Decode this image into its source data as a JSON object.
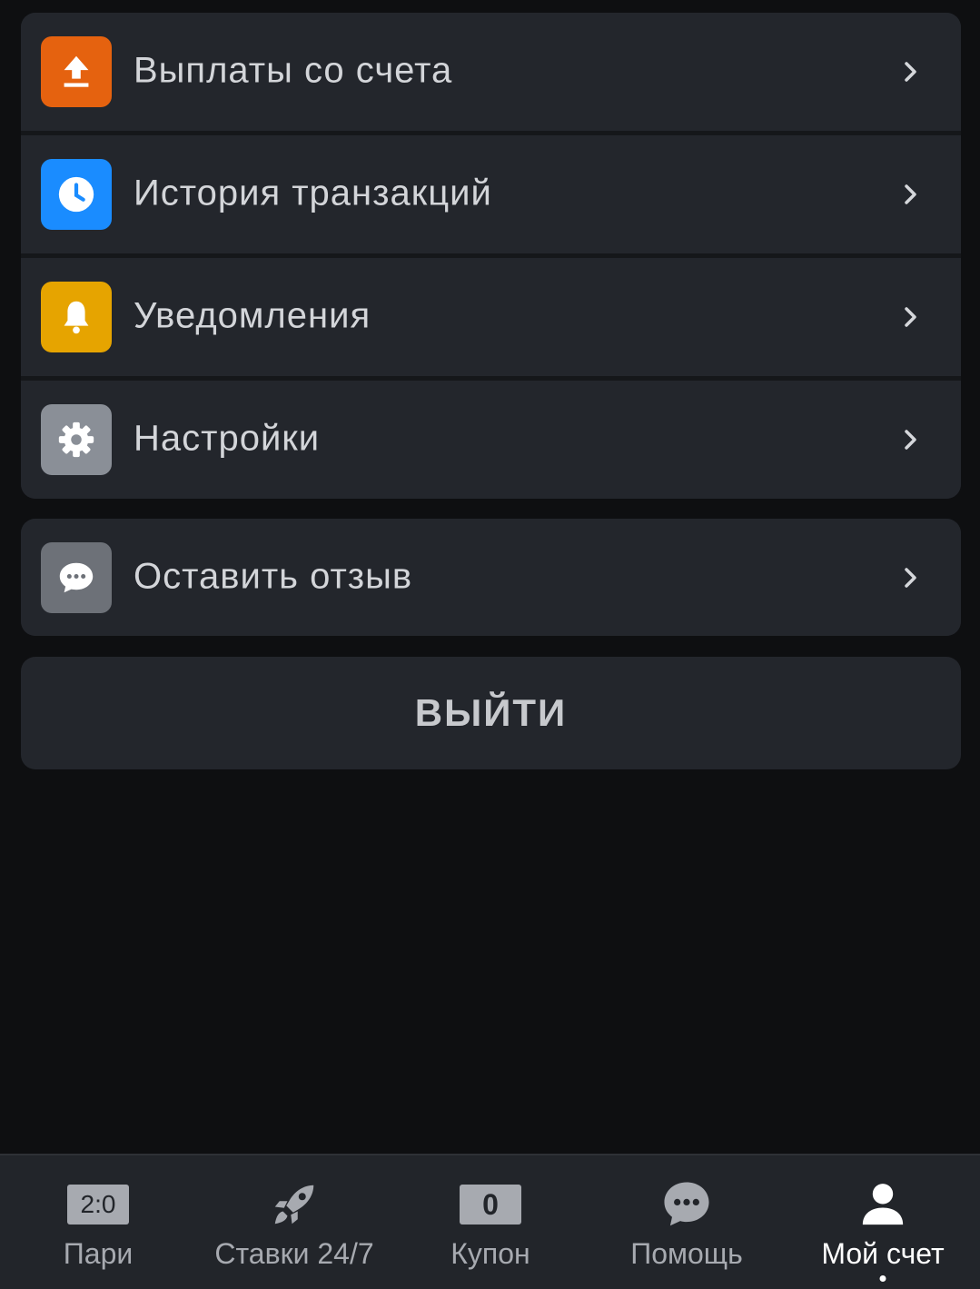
{
  "menu_group_1": [
    {
      "label": "Выплаты со счета",
      "icon": "upload-icon",
      "color": "#e5620f"
    },
    {
      "label": "История транзакций",
      "icon": "clock-icon",
      "color": "#1a8cff"
    },
    {
      "label": "Уведомления",
      "icon": "bell-icon",
      "color": "#e6a400"
    },
    {
      "label": "Настройки",
      "icon": "gear-icon",
      "color": "#8a8f97"
    }
  ],
  "menu_group_2": [
    {
      "label": "Оставить отзыв",
      "icon": "chat-bubble-icon",
      "color": "#6d7178"
    }
  ],
  "logout_label": "ВЫЙТИ",
  "tabbar": {
    "items": [
      {
        "label": "Пари",
        "icon": "score-icon",
        "badge": "2:0"
      },
      {
        "label": "Ставки 24/7",
        "icon": "rocket-icon"
      },
      {
        "label": "Купон",
        "icon": "coupon-icon",
        "badge": "0"
      },
      {
        "label": "Помощь",
        "icon": "chat-icon"
      },
      {
        "label": "Мой счет",
        "icon": "user-icon",
        "active": true
      }
    ]
  }
}
